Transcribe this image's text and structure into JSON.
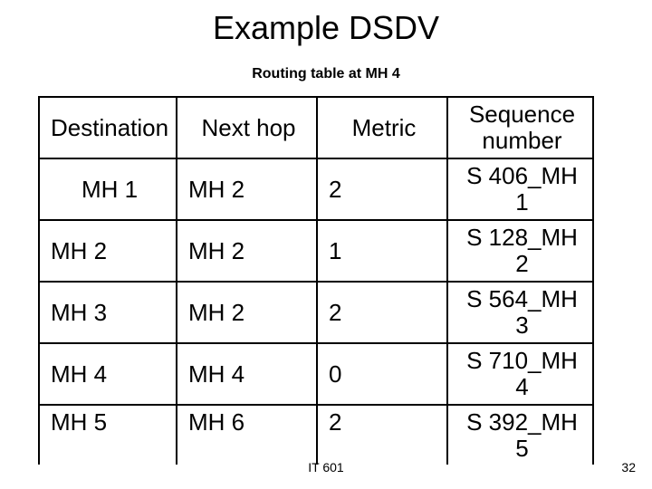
{
  "title": "Example DSDV",
  "subtitle": "Routing table at MH 4",
  "table": {
    "headers": [
      "Destination",
      "Next hop",
      "Metric",
      "Sequence number"
    ],
    "rows": [
      {
        "dest": "MH 1",
        "next": "MH 2",
        "metric": "2",
        "seq": "S 406_MH 1"
      },
      {
        "dest": "MH 2",
        "next": "MH 2",
        "metric": "1",
        "seq": "S 128_MH 2"
      },
      {
        "dest": "MH 3",
        "next": "MH 2",
        "metric": "2",
        "seq": "S 564_MH 3"
      },
      {
        "dest": "MH 4",
        "next": "MH 4",
        "metric": "0",
        "seq": "S 710_MH 4"
      },
      {
        "dest": "MH 5",
        "next": "MH 6",
        "metric": "2",
        "seq": "S 392_MH 5"
      }
    ]
  },
  "footer": {
    "center": "IT 601",
    "page": "32"
  }
}
